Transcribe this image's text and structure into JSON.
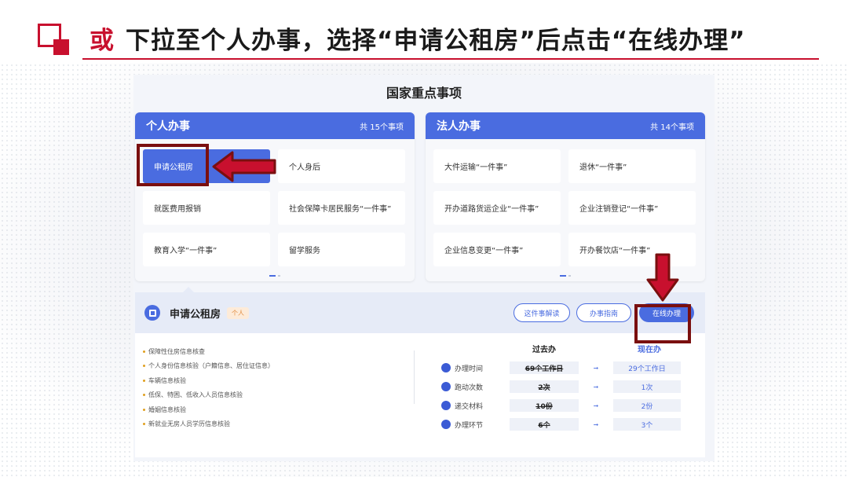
{
  "slide": {
    "prefix": "或",
    "instruction": "下拉至个人办事，选择“申请公租房”后点击“在线办理”"
  },
  "section_title": "国家重点事项",
  "personal": {
    "title": "个人办事",
    "count": "共 15个事项",
    "items": [
      "申请公租房",
      "个人身后",
      "就医费用报销",
      "社会保障卡居民服务“一件事”",
      "教育入学“一件事”",
      "留学服务"
    ]
  },
  "corporate": {
    "title": "法人办事",
    "count": "共 14个事项",
    "items": [
      "大件运输“一件事”",
      "退休“一件事”",
      "开办道路货运企业“一件事”",
      "企业注销登记“一件事”",
      "企业信息变更“一件事”",
      "开办餐饮店“一件事”"
    ]
  },
  "detail": {
    "title": "申请公租房",
    "tag": "个人",
    "buttons": {
      "explain": "这件事解读",
      "guide": "办事指南",
      "online": "在线办理"
    },
    "requirements": [
      "保障性住房信息核查",
      "个人身份信息核验（户籍信息、居住证信息）",
      "车辆信息核验",
      "低保、特困、低收入人员信息核验",
      "婚姻信息核验",
      "新就业无房人员学历信息核验"
    ],
    "compare": {
      "past_label": "过去办",
      "now_label": "现在办",
      "rows": [
        {
          "label": "办理时间",
          "icon": "clock-icon",
          "past": "69个工作日",
          "now": "29个工作日"
        },
        {
          "label": "跑动次数",
          "icon": "runner-icon",
          "past": "2次",
          "now": "1次"
        },
        {
          "label": "递交材料",
          "icon": "briefcase-icon",
          "past": "10份",
          "now": "2份"
        },
        {
          "label": "办理环节",
          "icon": "steps-icon",
          "past": "6个",
          "now": "3个"
        }
      ]
    }
  },
  "colors": {
    "accent": "#4a6ce0",
    "brand_red": "#c8102e",
    "annotation": "#7a0f0f"
  }
}
